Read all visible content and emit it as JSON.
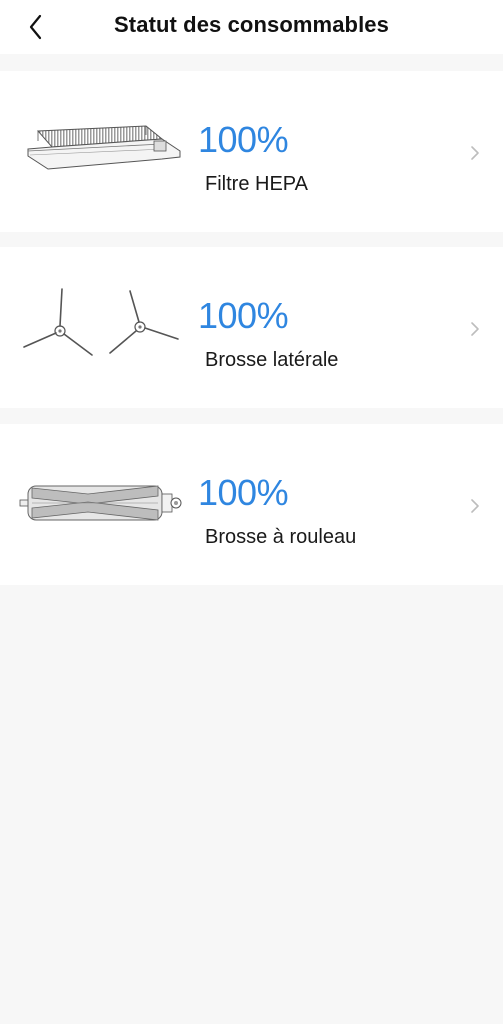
{
  "header": {
    "title": "Statut des consommables"
  },
  "items": [
    {
      "name": "Filtre HEPA",
      "percent": "100%",
      "level": 1.0,
      "icon": "hepa-filter-icon"
    },
    {
      "name": "Brosse latérale",
      "percent": "100%",
      "level": 1.0,
      "icon": "side-brush-icon"
    },
    {
      "name": "Brosse à rouleau",
      "percent": "100%",
      "level": 1.0,
      "icon": "roller-brush-icon"
    }
  ],
  "colors": {
    "accent": "#2f86e0",
    "background": "#f7f7f7",
    "card": "#ffffff"
  }
}
